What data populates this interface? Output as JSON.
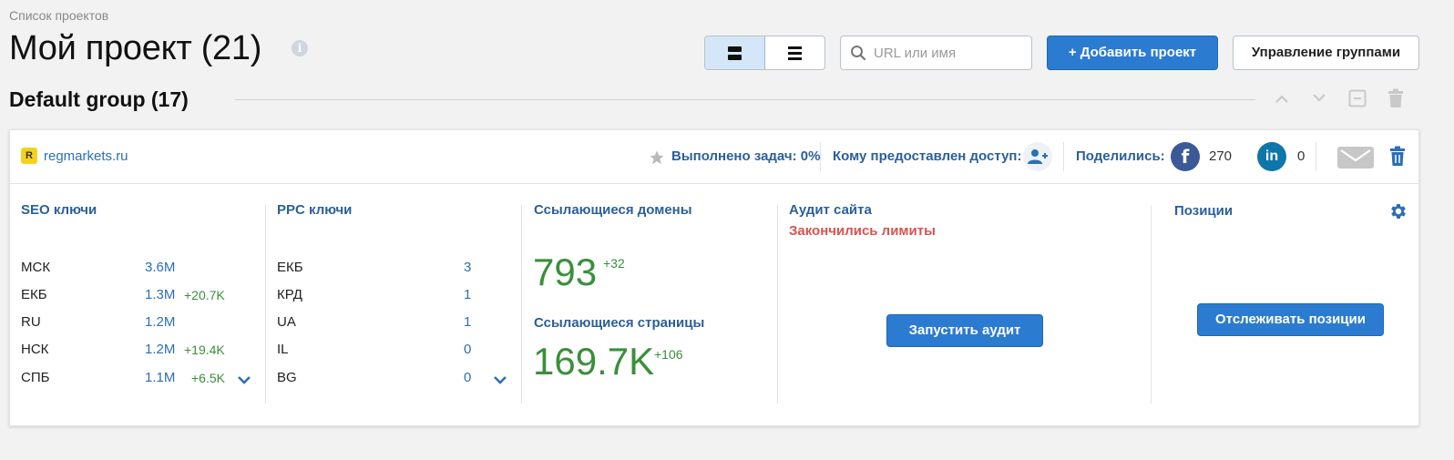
{
  "breadcrumb": "Список проектов",
  "title": "Мой проект (21)",
  "info_icon": "i",
  "search": {
    "placeholder": "URL или имя"
  },
  "add_project": "+ Добавить проект",
  "manage_groups": "Управление группами",
  "group": {
    "title": "Default group (17)"
  },
  "project": {
    "favicon_letter": "R",
    "site": "regmarkets.ru",
    "tasks_done": "Выполнено задач: 0%",
    "access_label": "Кому предоставлен доступ:",
    "shared_label": "Поделились:",
    "facebook_icon": "f",
    "facebook_count": "270",
    "linkedin_icon": "in",
    "linkedin_count": "0"
  },
  "seo": {
    "title": "SEO ключи",
    "rows": [
      {
        "label": "МСК",
        "value": "3.6M",
        "delta": ""
      },
      {
        "label": "ЕКБ",
        "value": "1.3M",
        "delta": "+20.7K"
      },
      {
        "label": "RU",
        "value": "1.2M",
        "delta": ""
      },
      {
        "label": "НСК",
        "value": "1.2M",
        "delta": "+19.4K"
      },
      {
        "label": "СПБ",
        "value": "1.1M",
        "delta": "+6.5K"
      }
    ]
  },
  "ppc": {
    "title": "PPC ключи",
    "rows": [
      {
        "label": "ЕКБ",
        "value": "3"
      },
      {
        "label": "КРД",
        "value": "1"
      },
      {
        "label": "UA",
        "value": "1"
      },
      {
        "label": "IL",
        "value": "0"
      },
      {
        "label": "BG",
        "value": "0"
      }
    ]
  },
  "links": {
    "domains_title": "Ссылающиеся домены",
    "domains_value": "793",
    "domains_delta": "+32",
    "pages_title": "Ссылающиеся страницы",
    "pages_value": "169.7K",
    "pages_delta": "+106"
  },
  "audit": {
    "title": "Аудит сайта",
    "error": "Закончились лимиты",
    "button": "Запустить аудит"
  },
  "positions": {
    "title": "Позиции",
    "button": "Отслеживать позиции"
  },
  "colors": {
    "accent": "#2b7bd1",
    "link": "#2b6fb6",
    "positive": "#3b8f3b",
    "error": "#d9534f",
    "facebook": "#3b5998",
    "linkedin": "#0e76a8"
  }
}
